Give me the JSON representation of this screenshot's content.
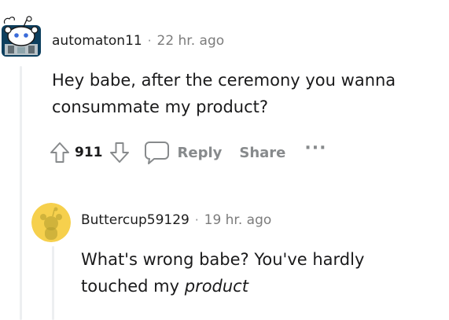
{
  "comments": [
    {
      "username": "automaton11",
      "separator": "·",
      "time": "22 hr. ago",
      "lines": [
        "Hey babe, after the ceremony you wanna",
        "consummate my product?"
      ],
      "score": "911",
      "actions": {
        "reply": "Reply",
        "share": "Share",
        "more": "···"
      },
      "avatar_icon": "robot-snoo-avatar"
    },
    {
      "username": "Buttercup59129",
      "separator": "·",
      "time": "19 hr. ago",
      "line1": "What's wrong babe? You've hardly",
      "line2_plain": "touched my ",
      "line2_italic": "product",
      "avatar_icon": "yellow-snoo-avatar"
    }
  ],
  "colors": {
    "avatar1_bg": "#0d3f5e",
    "avatar2_bg": "#f6d04d",
    "muted": "#878a8c",
    "text": "#1a1a1b"
  }
}
